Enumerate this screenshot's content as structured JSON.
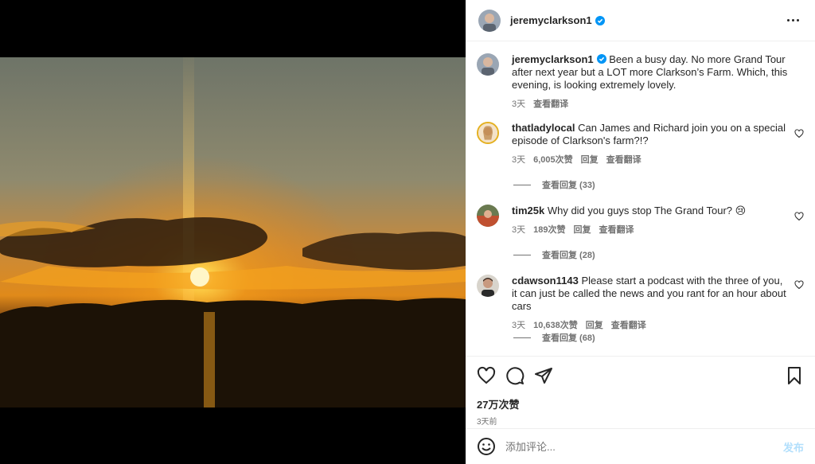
{
  "header": {
    "username": "jeremyclarkson1",
    "verified_icon": "verified-badge-icon",
    "more_icon": "more-options-icon"
  },
  "caption": {
    "username": "jeremyclarkson1",
    "text": "Been a busy day. No more Grand Tour after next year but a LOT more Clarkson’s Farm. Which, this evening, is looking extremely lovely.",
    "time": "3天",
    "translate": "查看翻译"
  },
  "comments": [
    {
      "username": "thatladylocal",
      "text": "Can James and Richard join you on a special episode of Clarkson's farm?!?",
      "time": "3天",
      "likes": "6,005次赞",
      "reply": "回复",
      "translate": "查看翻译",
      "view_replies": "查看回复 (33)"
    },
    {
      "username": "tim25k",
      "text": "Why did you guys stop The Grand Tour? 😢",
      "time": "3天",
      "likes": "189次赞",
      "reply": "回复",
      "translate": "查看翻译",
      "view_replies": "查看回复 (28)"
    },
    {
      "username": "cdawson1143",
      "text": "Please start a podcast with the three of you, it can just be called the news and you rant for an hour about cars",
      "time": "3天",
      "likes": "10,638次赞",
      "reply": "回复",
      "translate": "查看翻译",
      "view_replies": "查看回复 (68)"
    }
  ],
  "footer": {
    "like_count": "27万次赞",
    "posted": "3天前",
    "comment_placeholder": "添加评论...",
    "post_button": "发布"
  },
  "colors": {
    "accent_blue": "#0095f6",
    "muted": "#737373",
    "post_disabled": "#b2dffc"
  }
}
